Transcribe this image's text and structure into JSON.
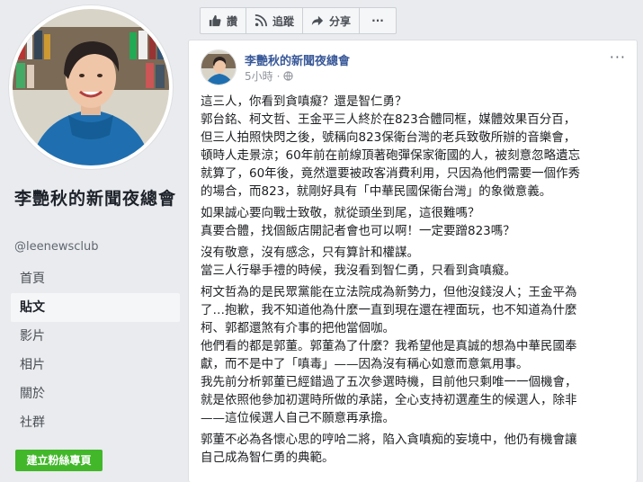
{
  "sidebar": {
    "page_name": "李艷秋的新聞夜總會",
    "handle": "@leenewsclub",
    "nav": [
      {
        "label": "首頁",
        "active": false
      },
      {
        "label": "貼文",
        "active": true
      },
      {
        "label": "影片",
        "active": false
      },
      {
        "label": "相片",
        "active": false
      },
      {
        "label": "關於",
        "active": false
      },
      {
        "label": "社群",
        "active": false
      }
    ],
    "create_page_label": "建立粉絲專頁"
  },
  "actions": {
    "like": "讚",
    "follow": "追蹤",
    "share": "分享",
    "more": "···"
  },
  "post": {
    "author": "李艷秋的新聞夜總會",
    "time": "5小時",
    "more": "···",
    "paragraphs": [
      [
        "這三人，你看到貪嗔癡？還是智仁勇？",
        "郭台銘、柯文哲、王金平三人終於在823合體同框，媒體效果百分百，",
        "但三人拍照快閃之後，號稱向823保衛台灣的老兵致敬所辦的音樂會，",
        "頓時人走景涼；60年前在前線頂著砲彈保家衛國的人，被刻意忽略遺忘",
        "就算了，60年後，竟然還要被政客消費利用，只因為他們需要一個作秀",
        "的場合，而823，就剛好具有「中華民國保衛台灣」的象徵意義。"
      ],
      [
        "如果誠心要向戰士致敬，就從頭坐到尾，這很難嗎？",
        "真要合體，找個飯店開記者會也可以啊！一定要蹭823嗎？"
      ],
      [
        "沒有敬意，沒有感念，只有算計和權謀。",
        "當三人行舉手禮的時候，我沒看到智仁勇，只看到貪嗔癡。"
      ],
      [
        "柯文哲為的是民眾黨能在立法院成為新勢力，但他沒錢沒人；王金平為",
        "了…抱歉，我不知道他為什麼一直到現在還在裡面玩，也不知道為什麼",
        "柯、郭都還煞有介事的把他當個咖。",
        "他們看的都是郭董。郭董為了什麼？我希望他是真誠的想為中華民國奉",
        "獻，而不是中了「嗔毒」——因為沒有稱心如意而意氣用事。",
        "我先前分析郭董已經錯過了五次參選時機，目前他只剩唯一一個機會，",
        "就是依照他參加初選時所做的承諾，全心支持初選產生的候選人，除非",
        "——這位候選人自己不願意再承擔。"
      ],
      [
        "郭董不必為各懷心思的哼哈二將，陷入貪嗔痴的妄境中，他仍有機會讓",
        "自己成為智仁勇的典範。"
      ]
    ]
  }
}
